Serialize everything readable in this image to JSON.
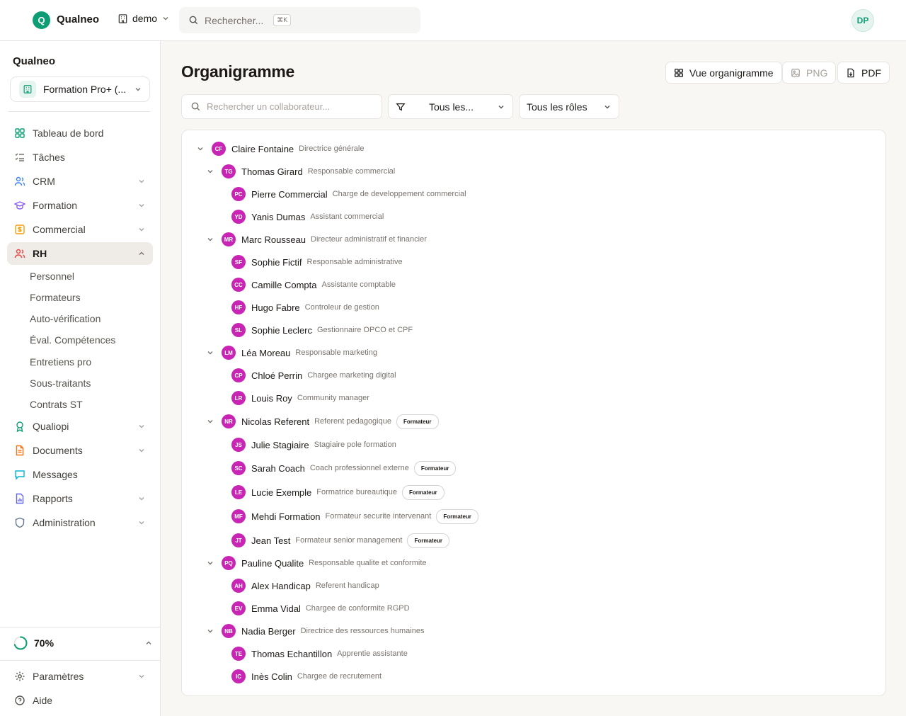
{
  "topbar": {
    "logo_letter": "Q",
    "brand": "Qualneo",
    "org_label": "demo",
    "search_placeholder": "Rechercher...",
    "search_shortcut": "⌘K",
    "user_initials": "DP"
  },
  "sidebar": {
    "title": "Qualneo",
    "workspace": "Formation Pro+ (...",
    "items": [
      {
        "label": "Tableau de bord",
        "icon": "dashboard-icon",
        "color": "#0f9d76"
      },
      {
        "label": "Tâches",
        "icon": "tasks-icon",
        "color": "#78716c"
      },
      {
        "label": "CRM",
        "icon": "users-icon",
        "color": "#3b82f6"
      },
      {
        "label": "Formation",
        "icon": "graduation-cap-icon",
        "color": "#8b5cf6"
      },
      {
        "label": "Commercial",
        "icon": "dollar-icon",
        "color": "#f59e0b"
      },
      {
        "label": "RH",
        "icon": "people-icon",
        "color": "#ef4444"
      },
      {
        "label": "Qualiopi",
        "icon": "award-icon",
        "color": "#0f9d76"
      },
      {
        "label": "Documents",
        "icon": "file-icon",
        "color": "#f97316"
      },
      {
        "label": "Messages",
        "icon": "message-icon",
        "color": "#06b6d4"
      },
      {
        "label": "Rapports",
        "icon": "report-icon",
        "color": "#6366f1"
      },
      {
        "label": "Administration",
        "icon": "shield-icon",
        "color": "#64748b"
      }
    ],
    "rh_subitems": [
      "Personnel",
      "Formateurs",
      "Auto-vérification",
      "Éval. Compétences",
      "Entretiens pro",
      "Sous-traitants",
      "Contrats ST"
    ],
    "progress": {
      "label": "70%",
      "value": 0.7
    },
    "footer": [
      {
        "label": "Paramètres",
        "icon": "gear-icon"
      },
      {
        "label": "Aide",
        "icon": "help-icon"
      }
    ]
  },
  "main": {
    "title": "Organigramme",
    "buttons": {
      "view": "Vue organigramme",
      "png": "PNG",
      "pdf": "PDF"
    },
    "filter": {
      "search_placeholder": "Rechercher un collaborateur...",
      "dept_select": "Tous les...",
      "role_select": "Tous les rôles"
    },
    "accent": "#c925b4",
    "tree": [
      {
        "level": 0,
        "expanded": true,
        "initials": "CF",
        "name": "Claire Fontaine",
        "role": "Directrice générale",
        "badge": ""
      },
      {
        "level": 1,
        "expanded": true,
        "initials": "TG",
        "name": "Thomas Girard",
        "role": "Responsable commercial",
        "badge": ""
      },
      {
        "level": 2,
        "initials": "PC",
        "name": "Pierre Commercial",
        "role": "Charge de developpement commercial",
        "badge": ""
      },
      {
        "level": 2,
        "initials": "YD",
        "name": "Yanis Dumas",
        "role": "Assistant commercial",
        "badge": ""
      },
      {
        "level": 1,
        "expanded": true,
        "initials": "MR",
        "name": "Marc Rousseau",
        "role": "Directeur administratif et financier",
        "badge": ""
      },
      {
        "level": 2,
        "initials": "SF",
        "name": "Sophie Fictif",
        "role": "Responsable administrative",
        "badge": ""
      },
      {
        "level": 2,
        "initials": "CC",
        "name": "Camille Compta",
        "role": "Assistante comptable",
        "badge": ""
      },
      {
        "level": 2,
        "initials": "HF",
        "name": "Hugo Fabre",
        "role": "Controleur de gestion",
        "badge": ""
      },
      {
        "level": 2,
        "initials": "SL",
        "name": "Sophie Leclerc",
        "role": "Gestionnaire OPCO et CPF",
        "badge": ""
      },
      {
        "level": 1,
        "expanded": true,
        "initials": "LM",
        "name": "Léa Moreau",
        "role": "Responsable marketing",
        "badge": ""
      },
      {
        "level": 2,
        "initials": "CP",
        "name": "Chloé Perrin",
        "role": "Chargee marketing digital",
        "badge": ""
      },
      {
        "level": 2,
        "initials": "LR",
        "name": "Louis Roy",
        "role": "Community manager",
        "badge": ""
      },
      {
        "level": 1,
        "expanded": true,
        "initials": "NR",
        "name": "Nicolas Referent",
        "role": "Referent pedagogique",
        "badge": "Formateur"
      },
      {
        "level": 2,
        "initials": "JS",
        "name": "Julie Stagiaire",
        "role": "Stagiaire pole formation",
        "badge": ""
      },
      {
        "level": 2,
        "initials": "SC",
        "name": "Sarah Coach",
        "role": "Coach professionnel externe",
        "badge": "Formateur"
      },
      {
        "level": 2,
        "initials": "LE",
        "name": "Lucie Exemple",
        "role": "Formatrice bureautique",
        "badge": "Formateur"
      },
      {
        "level": 2,
        "initials": "MF",
        "name": "Mehdi Formation",
        "role": "Formateur securite intervenant",
        "badge": "Formateur"
      },
      {
        "level": 2,
        "initials": "JT",
        "name": "Jean Test",
        "role": "Formateur senior management",
        "badge": "Formateur"
      },
      {
        "level": 1,
        "expanded": true,
        "initials": "PQ",
        "name": "Pauline Qualite",
        "role": "Responsable qualite et conformite",
        "badge": ""
      },
      {
        "level": 2,
        "initials": "AH",
        "name": "Alex Handicap",
        "role": "Referent handicap",
        "badge": ""
      },
      {
        "level": 2,
        "initials": "EV",
        "name": "Emma Vidal",
        "role": "Chargee de conformite RGPD",
        "badge": ""
      },
      {
        "level": 1,
        "expanded": true,
        "initials": "NB",
        "name": "Nadia Berger",
        "role": "Directrice des ressources humaines",
        "badge": ""
      },
      {
        "level": 2,
        "initials": "TE",
        "name": "Thomas Echantillon",
        "role": "Apprentie assistante",
        "badge": ""
      },
      {
        "level": 2,
        "initials": "IC",
        "name": "Inès Colin",
        "role": "Chargee de recrutement",
        "badge": ""
      }
    ]
  }
}
